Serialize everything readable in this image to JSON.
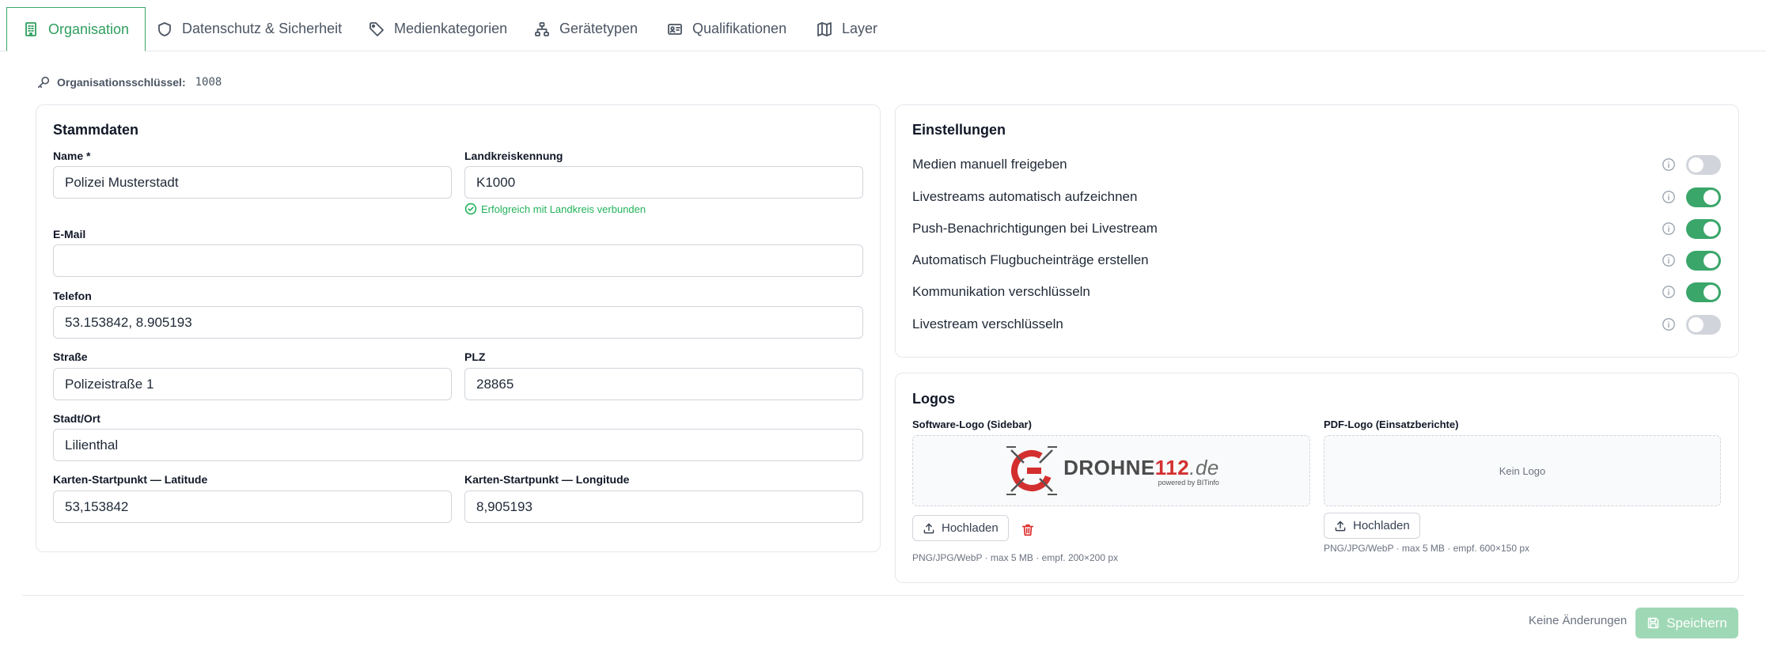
{
  "tabs": [
    {
      "label": "Organisation",
      "icon": "building-icon",
      "active": true
    },
    {
      "label": "Datenschutz & Sicherheit",
      "icon": "shield-icon"
    },
    {
      "label": "Medienkategorien",
      "icon": "tag-icon"
    },
    {
      "label": "Gerätetypen",
      "icon": "network-icon"
    },
    {
      "label": "Qualifikationen",
      "icon": "id-card-icon"
    },
    {
      "label": "Layer",
      "icon": "map-icon"
    }
  ],
  "org_key": {
    "label": "Organisationsschlüssel:",
    "value": "1008"
  },
  "stammdaten": {
    "title": "Stammdaten",
    "name": {
      "label": "Name *",
      "value": "Polizei Musterstadt"
    },
    "landkreis": {
      "label": "Landkreiskennung",
      "value": "K1000",
      "status": "Erfolgreich mit Landkreis verbunden"
    },
    "email": {
      "label": "E-Mail",
      "value": ""
    },
    "telefon": {
      "label": "Telefon",
      "value": "53.153842, 8.905193"
    },
    "strasse": {
      "label": "Straße",
      "value": "Polizeistraße 1"
    },
    "plz": {
      "label": "PLZ",
      "value": "28865"
    },
    "ort": {
      "label": "Stadt/Ort",
      "value": "Lilienthal"
    },
    "lat": {
      "label": "Karten-Startpunkt — Latitude",
      "value": "53,153842"
    },
    "lng": {
      "label": "Karten-Startpunkt — Longitude",
      "value": "8,905193"
    }
  },
  "einstellungen": {
    "title": "Einstellungen",
    "items": [
      {
        "label": "Medien manuell freigeben",
        "on": false
      },
      {
        "label": "Livestreams automatisch aufzeichnen",
        "on": true
      },
      {
        "label": "Push-Benachrichtigungen bei Livestream",
        "on": true
      },
      {
        "label": "Automatisch Flugbucheinträge erstellen",
        "on": true
      },
      {
        "label": "Kommunikation verschlüsseln",
        "on": true
      },
      {
        "label": "Livestream verschlüsseln",
        "on": false
      }
    ]
  },
  "logos": {
    "title": "Logos",
    "software": {
      "label": "Software-Logo (Sidebar)",
      "logo_main": "DROHNE",
      "logo_num": "112",
      "logo_tld": ".de",
      "logo_sub": "powered by BITinfo",
      "upload": "Hochladen",
      "hint": "PNG/JPG/WebP · max 5 MB · empf. 200×200 px"
    },
    "pdf": {
      "label": "PDF-Logo (Einsatzberichte)",
      "empty": "Kein Logo",
      "upload": "Hochladen",
      "hint": "PNG/JPG/WebP · max 5 MB · empf. 600×150 px"
    }
  },
  "footer": {
    "status": "Keine Änderungen",
    "save": "Speichern"
  },
  "colors": {
    "accent": "#3aa66a",
    "success": "#22b35a",
    "danger": "#dc2626",
    "toggle_off": "#d1d5db"
  }
}
